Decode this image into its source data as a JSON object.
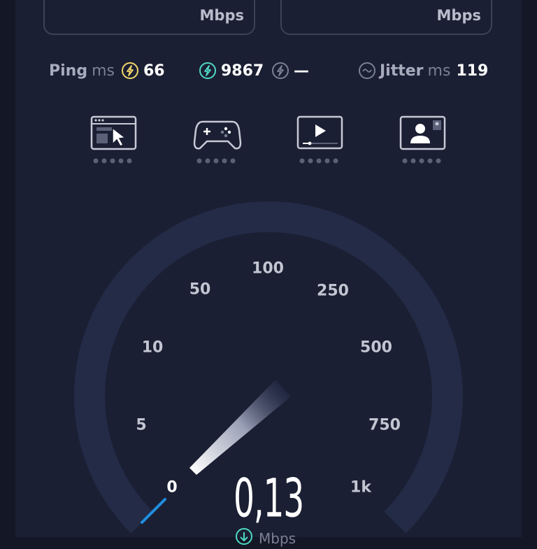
{
  "speed_cards": [
    {
      "unit": "Mbps"
    },
    {
      "unit": "Mbps"
    }
  ],
  "metrics": {
    "ping": {
      "label": "Ping",
      "unit": "ms",
      "value": "66"
    },
    "download_ping": {
      "value": "9867"
    },
    "upload_ping": {
      "value": "—"
    },
    "jitter": {
      "label": "Jitter",
      "unit": "ms",
      "value": "119"
    }
  },
  "quality_icons": [
    {
      "name": "web-browsing-icon",
      "dots": 5
    },
    {
      "name": "gaming-icon",
      "dots": 5
    },
    {
      "name": "video-streaming-icon",
      "dots": 5
    },
    {
      "name": "video-call-icon",
      "dots": 5
    }
  ],
  "gauge": {
    "ticks": [
      "0",
      "5",
      "10",
      "50",
      "100",
      "250",
      "500",
      "750",
      "1k"
    ],
    "current_value": "0,13",
    "unit": "Mbps",
    "colors": {
      "track": "#232b47",
      "progress": "#1f8fe0",
      "needle": "#ffffff",
      "label": "#c3c6d2"
    }
  }
}
